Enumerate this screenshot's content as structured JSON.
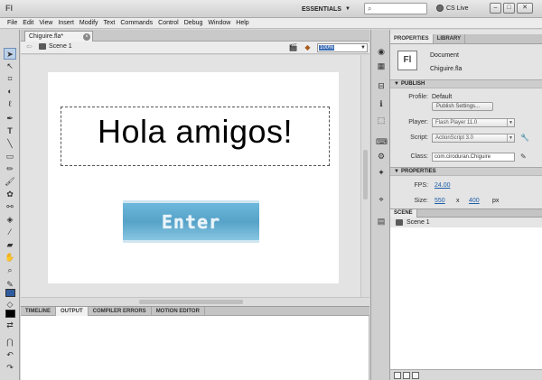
{
  "titlebar": {
    "logo": "Fl",
    "workspace": "ESSENTIALS",
    "search_placeholder": "",
    "cs_live": "CS Live",
    "minimize": "–",
    "maximize": "□",
    "close": "✕"
  },
  "menu": [
    "File",
    "Edit",
    "View",
    "Insert",
    "Modify",
    "Text",
    "Commands",
    "Control",
    "Debug",
    "Window",
    "Help"
  ],
  "document": {
    "tab_title": "Chiguire.fla*",
    "scene_name": "Scene 1",
    "zoom": "100%"
  },
  "stage": {
    "heading": "Hola amigos!",
    "button_label": "Enter",
    "button_color": "#5aa8cf"
  },
  "bottom_panel": {
    "tabs": [
      "TIMELINE",
      "OUTPUT",
      "COMPILER ERRORS",
      "MOTION EDITOR"
    ],
    "active_tab": "OUTPUT"
  },
  "properties": {
    "tabs": [
      "PROPERTIES",
      "LIBRARY"
    ],
    "doc_icon": "Fl",
    "doc_type": "Document",
    "doc_name": "Chiguire.fla",
    "publish": {
      "section": "PUBLISH",
      "profile_label": "Profile:",
      "profile_value": "Default",
      "publish_settings": "Publish Settings...",
      "player_label": "Player:",
      "player_value": "Flash Player 11.0",
      "script_label": "Script:",
      "script_value": "ActionScript 3.0",
      "class_label": "Class:",
      "class_value": "com.ciroduran.Chiguire"
    },
    "props": {
      "section": "PROPERTIES",
      "fps_label": "FPS:",
      "fps_value": "24.00",
      "size_label": "Size:",
      "width": "550",
      "x": "x",
      "height": "400",
      "unit": "px"
    }
  },
  "scene_panel": {
    "tab": "SCENE",
    "scenes": [
      "Scene 1"
    ]
  }
}
